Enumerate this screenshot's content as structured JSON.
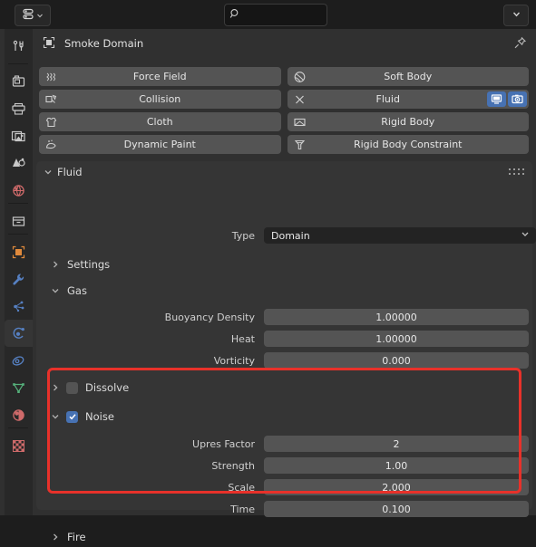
{
  "app": {
    "name": "Blender Properties Editor",
    "theme_bg": "#303030",
    "accent_blue": "#4772b3",
    "highlight_red": "#e8312a"
  },
  "topbar": {
    "editor_type_icon": "properties-editor-icon",
    "editor_type_chevron": "chevron-down-icon",
    "search": {
      "icon": "search-icon",
      "value": "",
      "placeholder": ""
    },
    "options_chevron": "chevron-down-icon"
  },
  "tabs": [
    {
      "name": "tool",
      "icon": "tool-icon",
      "color": "#c8c8c8",
      "active": false
    },
    {
      "name": "render",
      "icon": "camera-back-icon",
      "color": "#c8c8c8",
      "active": false
    },
    {
      "name": "output",
      "icon": "printer-icon",
      "color": "#c8c8c8",
      "active": false
    },
    {
      "name": "view-layer",
      "icon": "images-icon",
      "color": "#c8c8c8",
      "active": false
    },
    {
      "name": "scene",
      "icon": "scene-cone-icon",
      "color": "#c8c8c8",
      "active": false
    },
    {
      "name": "world",
      "icon": "world-globe-icon",
      "color": "#cf6a6a",
      "active": false
    },
    {
      "name": "collection",
      "icon": "collection-box-icon",
      "color": "#c8c8c8",
      "active": false
    },
    {
      "name": "object",
      "icon": "object-square-icon",
      "color": "#e08a3c",
      "active": false
    },
    {
      "name": "modifiers",
      "icon": "wrench-icon",
      "color": "#5680c2",
      "active": false
    },
    {
      "name": "particles",
      "icon": "particles-icon",
      "color": "#5680c2",
      "active": false
    },
    {
      "name": "physics",
      "icon": "physics-orbit-icon",
      "color": "#5680c2",
      "active": true
    },
    {
      "name": "constraints",
      "icon": "constraint-icon",
      "color": "#5680c2",
      "active": false
    },
    {
      "name": "object-data",
      "icon": "mesh-data-triangle-icon",
      "color": "#55b07a",
      "active": false
    },
    {
      "name": "material",
      "icon": "material-sphere-icon",
      "color": "#cf6a6a",
      "active": false
    },
    {
      "name": "texture",
      "icon": "texture-checker-icon",
      "color": "#cf6a6a",
      "active": false
    }
  ],
  "breadcrumb": {
    "icon": "object-icon",
    "label": "Smoke Domain",
    "pin_icon": "pin-icon"
  },
  "physics_buttons": [
    {
      "label": "Force Field",
      "icon": "force-field-icon",
      "enabled": false
    },
    {
      "label": "Soft Body",
      "icon": "soft-body-icon",
      "enabled": false
    },
    {
      "label": "Collision",
      "icon": "collision-icon",
      "enabled": false
    },
    {
      "label": "Fluid",
      "icon": "close-x-icon",
      "enabled": true,
      "toggles": [
        {
          "name": "display-in-viewport-toggle",
          "icon": "monitor-icon",
          "on": true
        },
        {
          "name": "render-toggle",
          "icon": "camera-icon",
          "on": true
        }
      ]
    },
    {
      "label": "Cloth",
      "icon": "cloth-shirt-icon",
      "enabled": false
    },
    {
      "label": "Rigid Body",
      "icon": "rigid-body-icon",
      "enabled": false
    },
    {
      "label": "Dynamic Paint",
      "icon": "dynamic-paint-icon",
      "enabled": false
    },
    {
      "label": "Rigid Body Constraint",
      "icon": "rigid-body-constraint-icon",
      "enabled": false
    }
  ],
  "fluid_panel": {
    "header": {
      "label": "Fluid",
      "chevron": "chevron-down-icon",
      "grip_icon": "drag-grip-icon"
    },
    "type_row": {
      "label": "Type",
      "value": "Domain",
      "chevron": "chevron-down-icon"
    },
    "settings_sub": {
      "label": "Settings",
      "chevron": "chevron-right-icon",
      "expanded": false
    },
    "gas_sub": {
      "label": "Gas",
      "chevron": "chevron-down-icon",
      "expanded": true,
      "fields": [
        {
          "label": "Buoyancy Density",
          "value": "1.00000",
          "decorator": true
        },
        {
          "label": "Heat",
          "value": "1.00000",
          "decorator": true
        },
        {
          "label": "Vorticity",
          "value": "0.000",
          "decorator": true
        }
      ]
    },
    "dissolve_sub": {
      "label": "Dissolve",
      "chevron": "chevron-right-icon",
      "checked": false,
      "expanded": false
    },
    "noise_sub": {
      "label": "Noise",
      "chevron": "chevron-down-icon",
      "checked": true,
      "expanded": true,
      "highlighted": true,
      "fields": [
        {
          "label": "Upres Factor",
          "value": "2",
          "decorator": false
        },
        {
          "label": "Strength",
          "value": "1.00",
          "decorator": true
        },
        {
          "label": "Scale",
          "value": "2.000",
          "decorator": true
        },
        {
          "label": "Time",
          "value": "0.100",
          "decorator": true
        }
      ]
    },
    "fire_sub": {
      "label": "Fire",
      "chevron": "chevron-right-icon",
      "expanded": false
    }
  }
}
